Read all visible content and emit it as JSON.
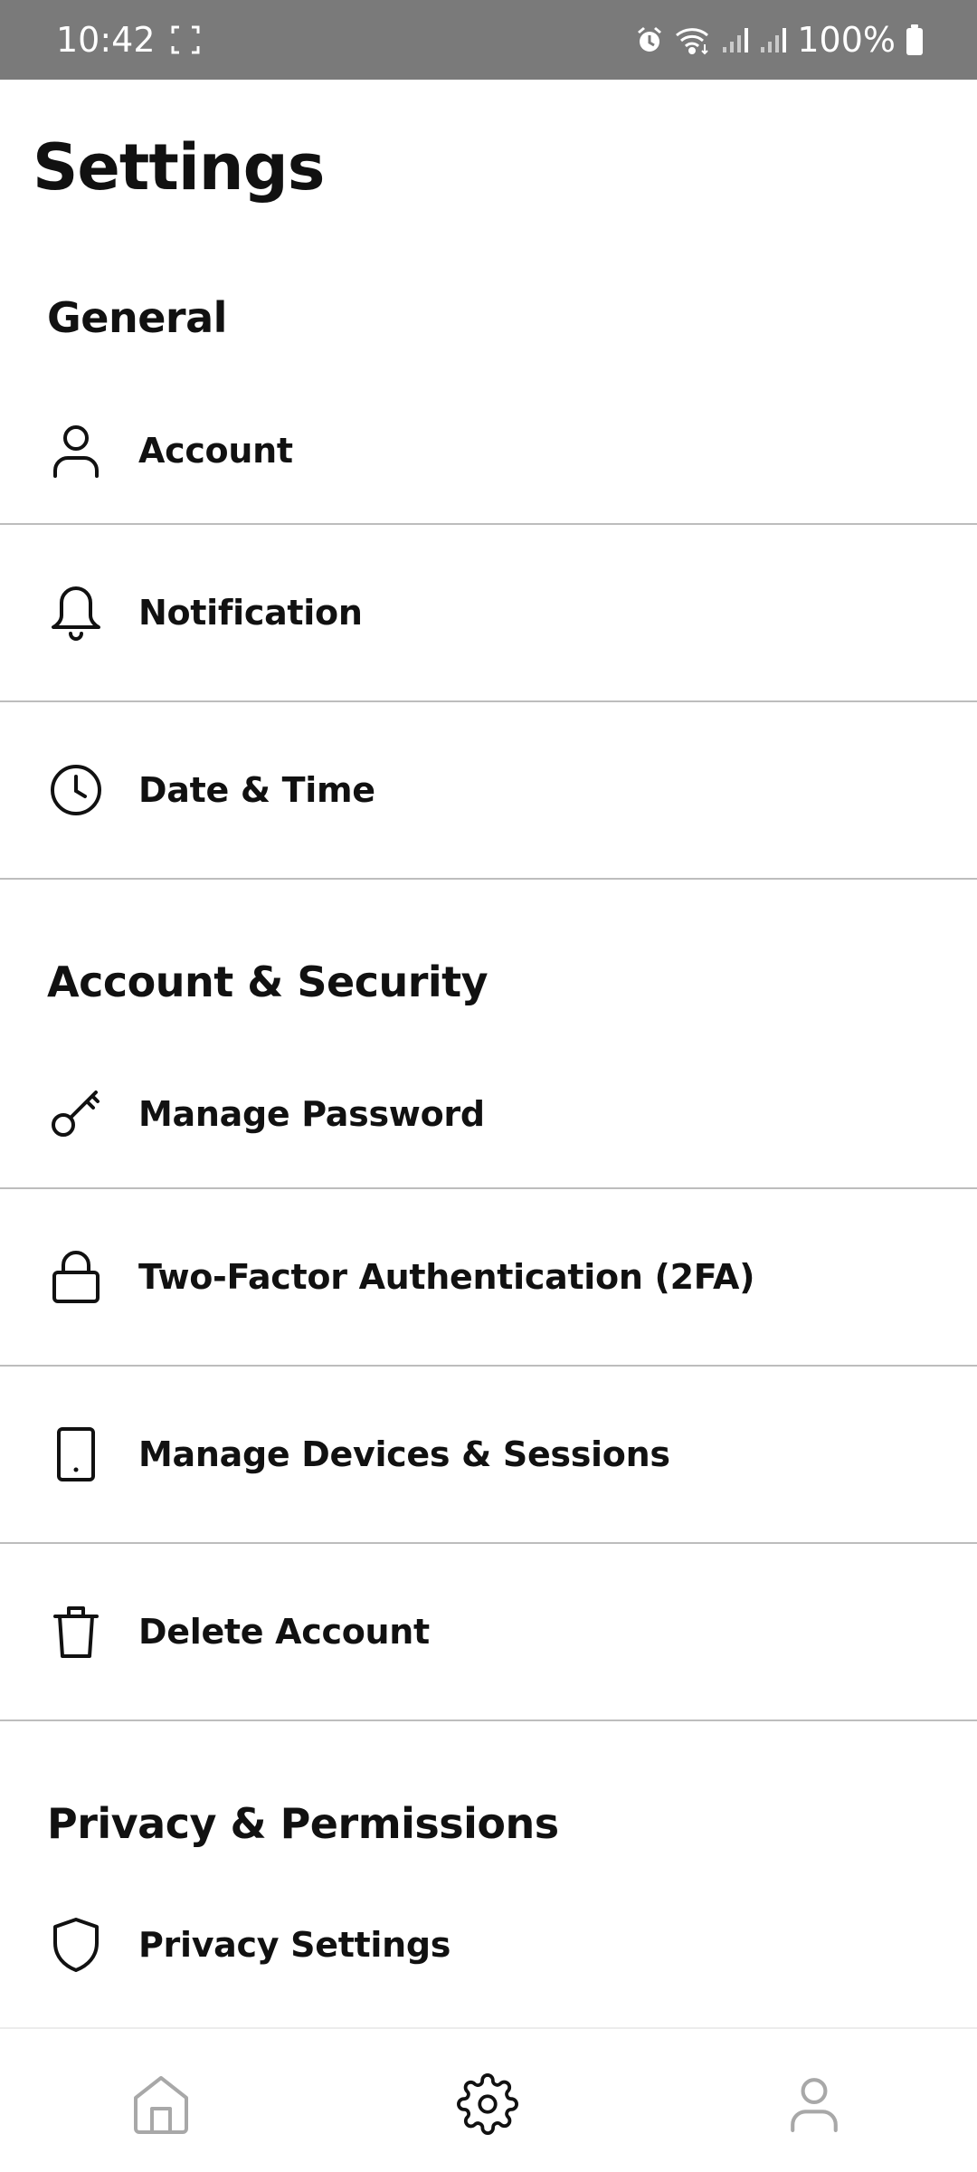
{
  "status_bar": {
    "time": "10:42",
    "battery": "100%",
    "icons": [
      "screenshot-icon",
      "alarm-icon",
      "wifi-icon",
      "signal-icon",
      "signal-icon",
      "battery-icon"
    ]
  },
  "page": {
    "title": "Settings"
  },
  "sections": [
    {
      "header": "General",
      "items": [
        {
          "label": "Account",
          "icon": "user-icon"
        },
        {
          "label": "Notification",
          "icon": "bell-icon"
        },
        {
          "label": "Date & Time",
          "icon": "clock-icon"
        }
      ]
    },
    {
      "header": "Account & Security",
      "items": [
        {
          "label": "Manage Password",
          "icon": "key-icon"
        },
        {
          "label": "Two-Factor Authentication (2FA)",
          "icon": "lock-icon"
        },
        {
          "label": "Manage Devices & Sessions",
          "icon": "phone-icon"
        },
        {
          "label": "Delete Account",
          "icon": "trash-icon"
        }
      ]
    },
    {
      "header": "Privacy & Permissions",
      "items": [
        {
          "label": "Privacy Settings",
          "icon": "shield-icon"
        }
      ]
    }
  ],
  "bottom_nav": {
    "items": [
      {
        "icon": "home-icon",
        "active": false
      },
      {
        "icon": "gear-icon",
        "active": true
      },
      {
        "icon": "profile-icon",
        "active": false
      }
    ],
    "colors": {
      "active": "#111111",
      "inactive": "#a8a8a8"
    }
  }
}
